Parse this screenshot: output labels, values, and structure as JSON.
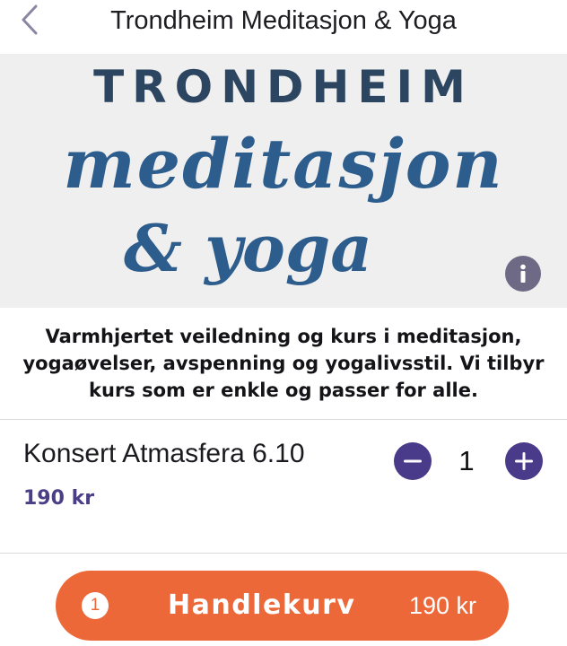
{
  "header": {
    "title": "Trondheim Meditasjon & Yoga",
    "back_icon": "chevron-left-icon",
    "icon_color": "#8a86a3"
  },
  "banner": {
    "logo_title": "TRONDHEIM",
    "logo_script_line1": "meditasjon",
    "logo_script_line2": "& yoga",
    "background_color": "#efefef",
    "logo_colors": {
      "title": "#2c4661",
      "script": "#2d5d8c"
    },
    "info_icon": "info-icon"
  },
  "description": "Varmhjertet veiledning og kurs i meditasjon, yogaøvelser, avspenning og yogalivsstil. Vi tilbyr kurs som er enkle og passer for alle.",
  "product": {
    "name": "Konsert Atmasfera 6.10",
    "price": "190 kr",
    "quantity": "1",
    "minus_icon": "minus-circle-icon",
    "plus_icon": "plus-circle-icon",
    "accent_color": "#4a3a8a"
  },
  "cart": {
    "count": "1",
    "label": "Handlekurv",
    "total": "190 kr",
    "button_color": "#ec6838"
  }
}
